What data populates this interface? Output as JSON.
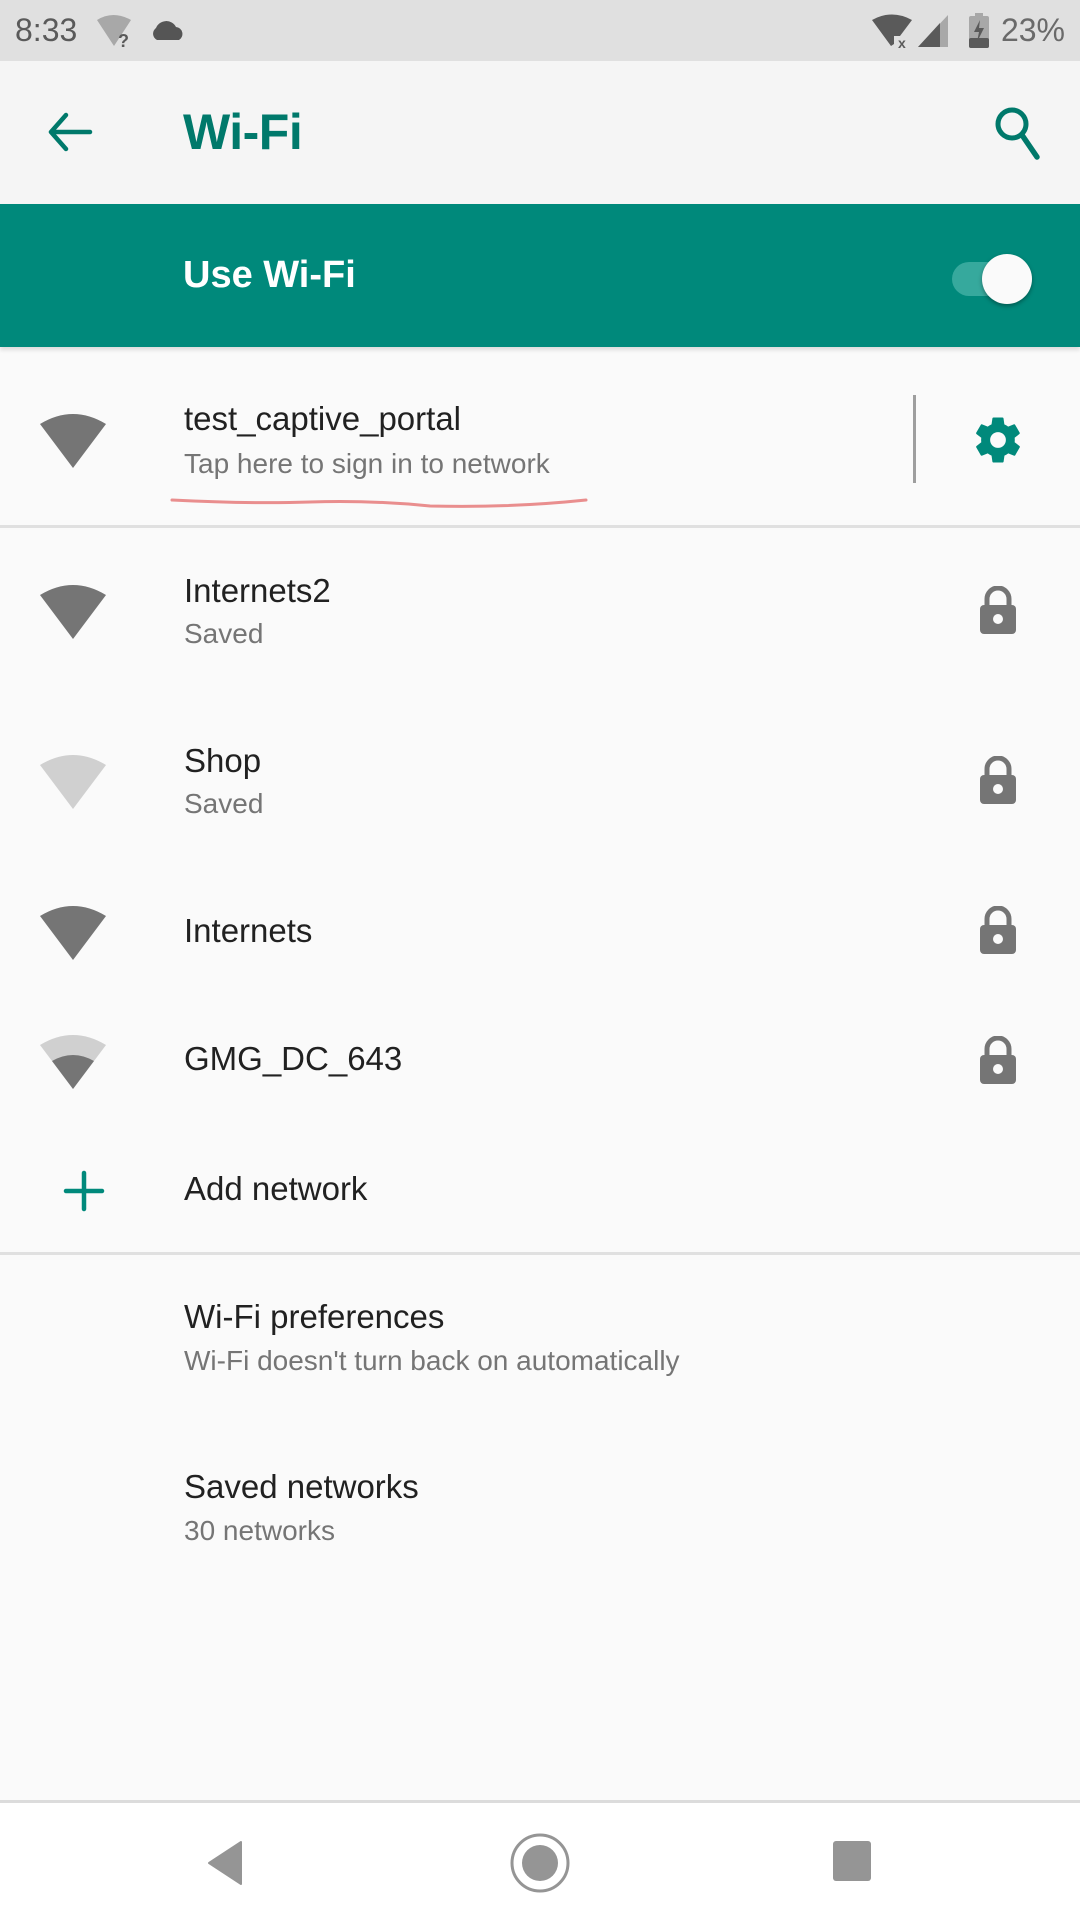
{
  "status_bar": {
    "time": "8:33",
    "left_icons": [
      "wifi-question-icon",
      "cloud-icon"
    ],
    "right_icons": [
      "wifi-off-icon",
      "cell-signal-icon",
      "battery-charging-icon"
    ],
    "battery_percent": "23%"
  },
  "app_bar": {
    "title": "Wi-Fi",
    "back_icon": "arrow-back-icon",
    "search_icon": "search-icon"
  },
  "master_switch": {
    "label": "Use Wi-Fi",
    "enabled": true
  },
  "connected_network": {
    "name": "test_captive_portal",
    "status": "Tap here to sign in to network",
    "signal_level": 4,
    "settings_icon": "gear-icon"
  },
  "networks": [
    {
      "name": "Internets2",
      "status": "Saved",
      "signal_level": 4,
      "secured": true
    },
    {
      "name": "Shop",
      "status": "Saved",
      "signal_level": 0,
      "secured": true
    },
    {
      "name": "Internets",
      "status": "",
      "signal_level": 4,
      "secured": true
    },
    {
      "name": "GMG_DC_643",
      "status": "",
      "signal_level": 2,
      "secured": true
    }
  ],
  "add_network": {
    "label": "Add network",
    "icon": "plus-icon"
  },
  "preferences": [
    {
      "title": "Wi-Fi preferences",
      "summary": "Wi-Fi doesn't turn back on automatically"
    },
    {
      "title": "Saved networks",
      "summary": "30 networks"
    }
  ],
  "nav_bar": {
    "buttons": [
      "back",
      "home",
      "recents"
    ]
  },
  "colors": {
    "accent": "#00897b",
    "accent_dark": "#00796b",
    "icon_gray": "#757575",
    "annotation": "#e57373"
  }
}
